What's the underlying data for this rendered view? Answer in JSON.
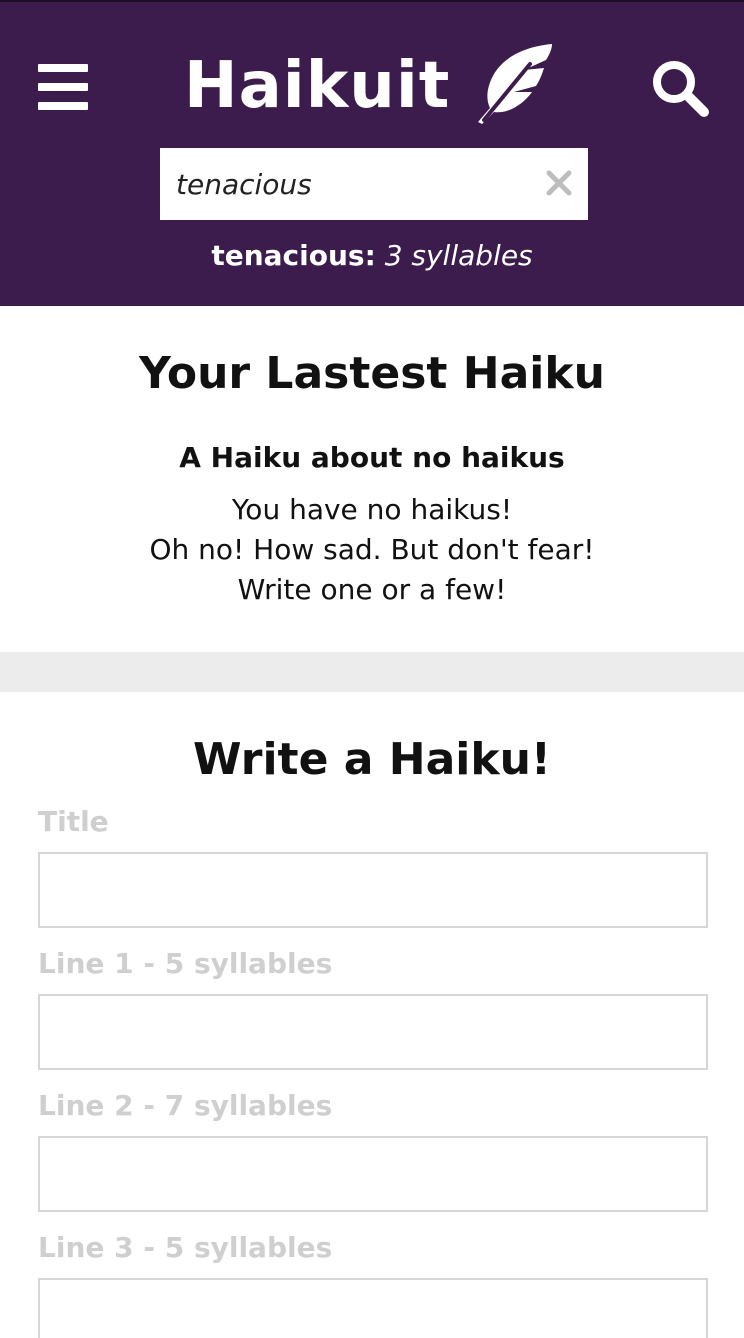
{
  "header": {
    "logo_text": "Haikuit",
    "search": {
      "value": "tenacious",
      "placeholder": ""
    },
    "syllable_result": {
      "word": "tenacious:",
      "count": "3 syllables"
    },
    "colors": {
      "header_background": "#3c1c4c",
      "header_text": "#ffffff"
    },
    "icons": {
      "menu": "hamburger-menu-icon",
      "logo": "feather-icon",
      "search": "search-icon",
      "clear": "close-icon"
    }
  },
  "latest": {
    "heading": "Your Lastest Haiku",
    "haiku": {
      "title": "A Haiku about no haikus",
      "lines": [
        "You have no haikus!",
        "Oh no! How sad. But don't fear!",
        "Write one or a few!"
      ]
    }
  },
  "write": {
    "heading": "Write a Haiku!",
    "fields": [
      {
        "label": "Title",
        "value": ""
      },
      {
        "label": "Line 1 - 5 syllables",
        "value": ""
      },
      {
        "label": "Line 2 - 7 syllables",
        "value": ""
      },
      {
        "label": "Line 3 - 5 syllables",
        "value": ""
      }
    ],
    "colors": {
      "label_text": "#cfcfcf",
      "input_border": "#d6d6d6",
      "divider": "#ececec"
    }
  }
}
